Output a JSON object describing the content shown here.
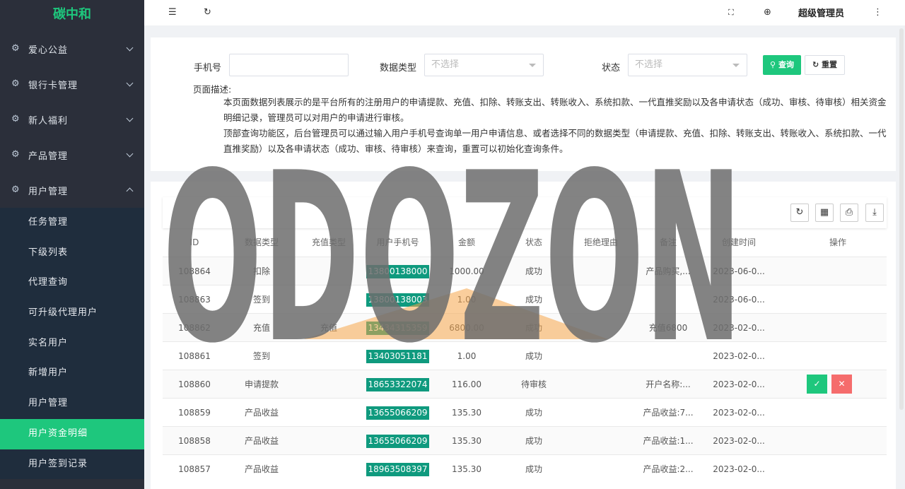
{
  "app": {
    "logo": "碳中和"
  },
  "sidebar": {
    "groups": [
      {
        "label": "爱心公益"
      },
      {
        "label": "银行卡管理"
      },
      {
        "label": "新人福利"
      },
      {
        "label": "产品管理"
      },
      {
        "label": "用户管理"
      }
    ],
    "sub_items": [
      {
        "label": "任务管理"
      },
      {
        "label": "下级列表"
      },
      {
        "label": "代理查询"
      },
      {
        "label": "可升级代理用户"
      },
      {
        "label": "实名用户"
      },
      {
        "label": "新增用户"
      },
      {
        "label": "用户管理"
      },
      {
        "label": "用户资金明细"
      },
      {
        "label": "用户签到记录"
      }
    ],
    "active": "用户资金明细",
    "accent": "#1ec77d"
  },
  "header": {
    "admin": "超级管理员"
  },
  "search": {
    "phone_label": "手机号",
    "type_label": "数据类型",
    "type_placeholder": "不选择",
    "status_label": "状态",
    "status_placeholder": "不选择",
    "search_button": "查询",
    "reset_button": "重置"
  },
  "description": {
    "title": "页面描述:",
    "line1": "本页面数据列表展示的是平台所有的注册用户的申请提款、充值、扣除、转账支出、转账收入、系统扣款、一代直推奖励以及各申请状态（成功、审核、待审核）相关资金",
    "line2": "明细记录，管理员可以对用户的申请进行审核。",
    "line3": "顶部查询功能区，后台管理员可以通过输入用户手机号查询单一用户申请信息、或者选择不同的数据类型（申请提款、充值、扣除、转账支出、转账收入、系统扣款、一代",
    "line4": "直推奖励）以及各申请状态（成功、审核、待审核）来查询，重置可以初始化查询条件。"
  },
  "table": {
    "headers": [
      "ID",
      "数据类型",
      "充值类型",
      "用户手机号",
      "金额",
      "状态",
      "拒绝理由",
      "备注",
      "创建时间",
      "操作"
    ],
    "rows": [
      {
        "id": "108864",
        "type": "扣除",
        "recharge": "",
        "phone": "13800138000",
        "amount": "1000.00",
        "status": "成功",
        "reason": "",
        "note": "产品购买,...",
        "time": "2023-06-0..."
      },
      {
        "id": "108863",
        "type": "签到",
        "recharge": "",
        "phone": "13800138003",
        "amount": "1.00",
        "status": "成功",
        "reason": "",
        "note": "",
        "time": "2023-06-0..."
      },
      {
        "id": "108862",
        "type": "充值",
        "recharge": "充值",
        "phone": "13434315359",
        "amount": "6800.00",
        "status": "成功",
        "reason": "",
        "note": "充值6800",
        "time": "2023-02-0..."
      },
      {
        "id": "108861",
        "type": "签到",
        "recharge": "",
        "phone": "13403051181",
        "amount": "1.00",
        "status": "成功",
        "reason": "",
        "note": "",
        "time": "2023-02-0..."
      },
      {
        "id": "108860",
        "type": "申请提款",
        "recharge": "",
        "phone": "18653322074",
        "amount": "116.00",
        "status": "待审核",
        "reason": "",
        "note": "开户名称:...",
        "time": "2023-02-0..."
      },
      {
        "id": "108859",
        "type": "产品收益",
        "recharge": "",
        "phone": "13655066209",
        "amount": "135.30",
        "status": "成功",
        "reason": "",
        "note": "产品收益:7...",
        "time": "2023-02-0..."
      },
      {
        "id": "108858",
        "type": "产品收益",
        "recharge": "",
        "phone": "13655066209",
        "amount": "135.30",
        "status": "成功",
        "reason": "",
        "note": "产品收益:1...",
        "time": "2023-02-0..."
      },
      {
        "id": "108857",
        "type": "产品收益",
        "recharge": "",
        "phone": "18963508397",
        "amount": "135.30",
        "status": "成功",
        "reason": "",
        "note": "产品收益:2...",
        "time": "2023-02-0..."
      }
    ]
  },
  "watermark": {
    "text": "ODOZON",
    "color": "#6e6e6e",
    "accent": "#f5a64a"
  },
  "icons": {
    "check": "✓",
    "cross": "✕",
    "search": "⚲",
    "reset": "↻"
  }
}
